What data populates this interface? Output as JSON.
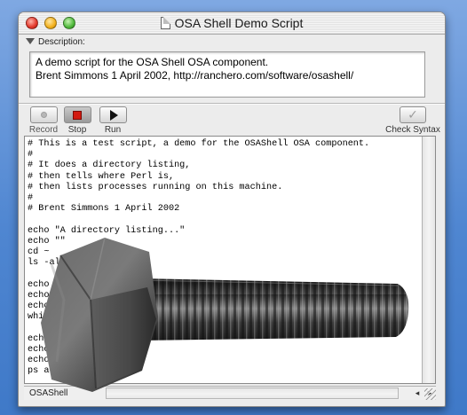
{
  "window": {
    "title": "OSA Shell Demo Script"
  },
  "description": {
    "label": "Description:",
    "lines": [
      "A demo script for the OSA Shell OSA component.",
      "Brent Simmons 1 April 2002, http://ranchero.com/software/osashell/"
    ]
  },
  "toolbar": {
    "record_label": "Record",
    "stop_label": "Stop",
    "run_label": "Run",
    "check_syntax_label": "Check Syntax"
  },
  "script": {
    "code": "# This is a test script, a demo for the OSAShell OSA component.\n#\n# It does a directory listing,\n# then tells where Perl is,\n# then lists processes running on this machine.\n#\n# Brent Simmons 1 April 2002\n\necho \"A directory listing...\"\necho \"\"\ncd ~\nls -al\n\necho\necho\necho\nwhi\n\necho\necho\necho\nps a"
  },
  "status": {
    "language": "OSAShell"
  },
  "colors": {
    "desktop": "#4f86d1",
    "stop_icon": "#d21a10",
    "window_bg": "#ececec"
  },
  "icons": [
    "document-icon",
    "disclosure-triangle-icon",
    "record-icon",
    "stop-icon",
    "play-icon",
    "checkmark-icon",
    "bolt-image"
  ]
}
